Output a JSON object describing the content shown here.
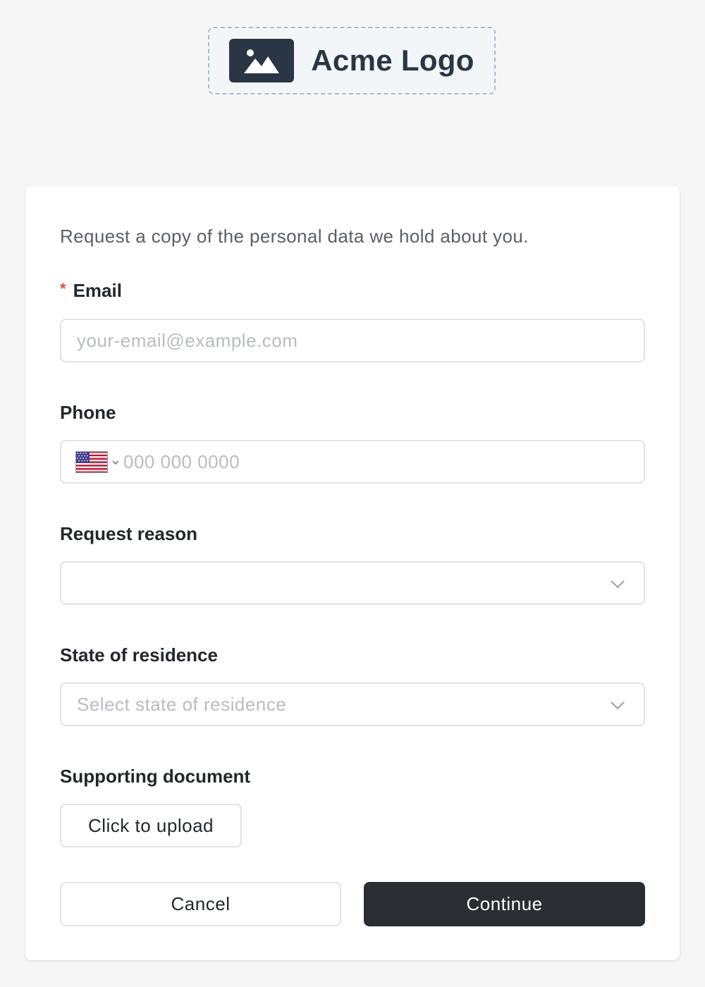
{
  "logo": {
    "icon": "image-icon",
    "text": "Acme Logo"
  },
  "form": {
    "intro": "Request a copy of the personal data we hold about you.",
    "email": {
      "required_mark": "*",
      "label": "Email",
      "placeholder": "your-email@example.com",
      "value": ""
    },
    "phone": {
      "label": "Phone",
      "country_flag": "us-flag-icon",
      "placeholder": "000 000 0000",
      "value": ""
    },
    "request_reason": {
      "label": "Request reason",
      "selected": ""
    },
    "state_of_residence": {
      "label": "State of residence",
      "placeholder": "Select state of residence"
    },
    "supporting_document": {
      "label": "Supporting document",
      "upload_label": "Click to upload"
    },
    "actions": {
      "cancel_label": "Cancel",
      "continue_label": "Continue"
    }
  },
  "colors": {
    "page_bg": "#f6f6f7",
    "brand_dark": "#2b3645",
    "primary_button": "#2a2d31",
    "required": "#e5484d",
    "border": "#e2e3e6"
  }
}
